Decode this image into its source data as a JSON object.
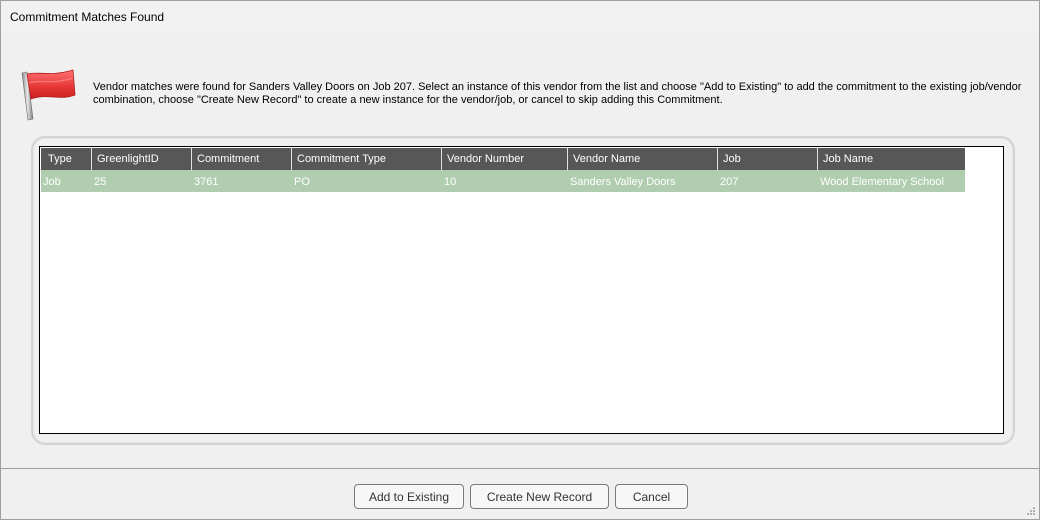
{
  "window": {
    "title": "Commitment Matches Found"
  },
  "message": {
    "icon": "red-flag-icon",
    "text": "Vendor matches were found for Sanders Valley Doors on Job 207.  Select an instance of this vendor from the list and choose \"Add to Existing\" to add the commitment to the existing job/vendor combination, choose \"Create New Record\" to create a new instance for the vendor/job, or cancel to skip adding this Commitment."
  },
  "grid": {
    "columns": [
      "Type",
      "GreenlightID",
      "Commitment",
      "Commitment Type",
      "Vendor Number",
      "Vendor Name",
      "Job",
      "Job Name"
    ],
    "rows": [
      [
        "Job",
        "25",
        "3761",
        "PO",
        "10",
        "Sanders Valley Doors",
        "207",
        "Wood Elementary School"
      ]
    ],
    "selected_row_color": "#b1cdb0",
    "header_color": "#575757"
  },
  "buttons": {
    "add_existing": "Add to Existing",
    "create_new": "Create New Record",
    "cancel": "Cancel"
  }
}
